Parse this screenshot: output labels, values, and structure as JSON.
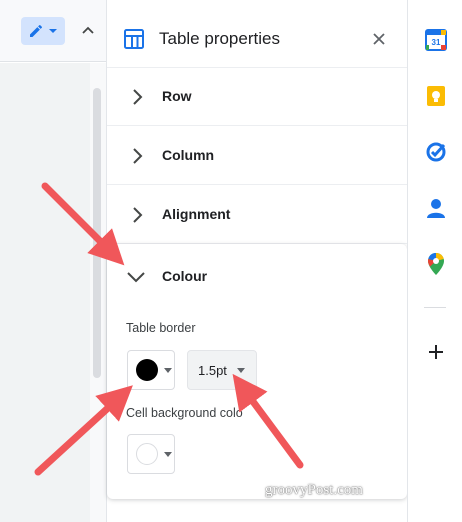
{
  "panel": {
    "title": "Table properties",
    "sections": [
      {
        "label": "Row",
        "expanded": false
      },
      {
        "label": "Column",
        "expanded": false
      },
      {
        "label": "Alignment",
        "expanded": false
      },
      {
        "label": "Colour",
        "expanded": true
      }
    ],
    "colour": {
      "table_border_label": "Table border",
      "border_color": "#000000",
      "border_weight": "1.5pt",
      "cell_background_label": "Cell background colo",
      "cell_background_color": "#ffffff"
    }
  },
  "watermark": "groovyPost.com",
  "icons": {
    "edit_mode": "pencil-icon",
    "collapse": "chevron-up-icon",
    "panel": "table-icon",
    "close": "close-icon",
    "rail": [
      "calendar-icon",
      "keep-icon",
      "tasks-icon",
      "contacts-icon",
      "maps-icon",
      "plus-icon"
    ]
  },
  "calendar_day": "31",
  "colors": {
    "accent": "#1a73e8",
    "edit_mode_bg": "#d3e3fd",
    "annotation_arrow": "#f0575a",
    "keep": "#fbbc04",
    "contacts": "#1a73e8"
  }
}
